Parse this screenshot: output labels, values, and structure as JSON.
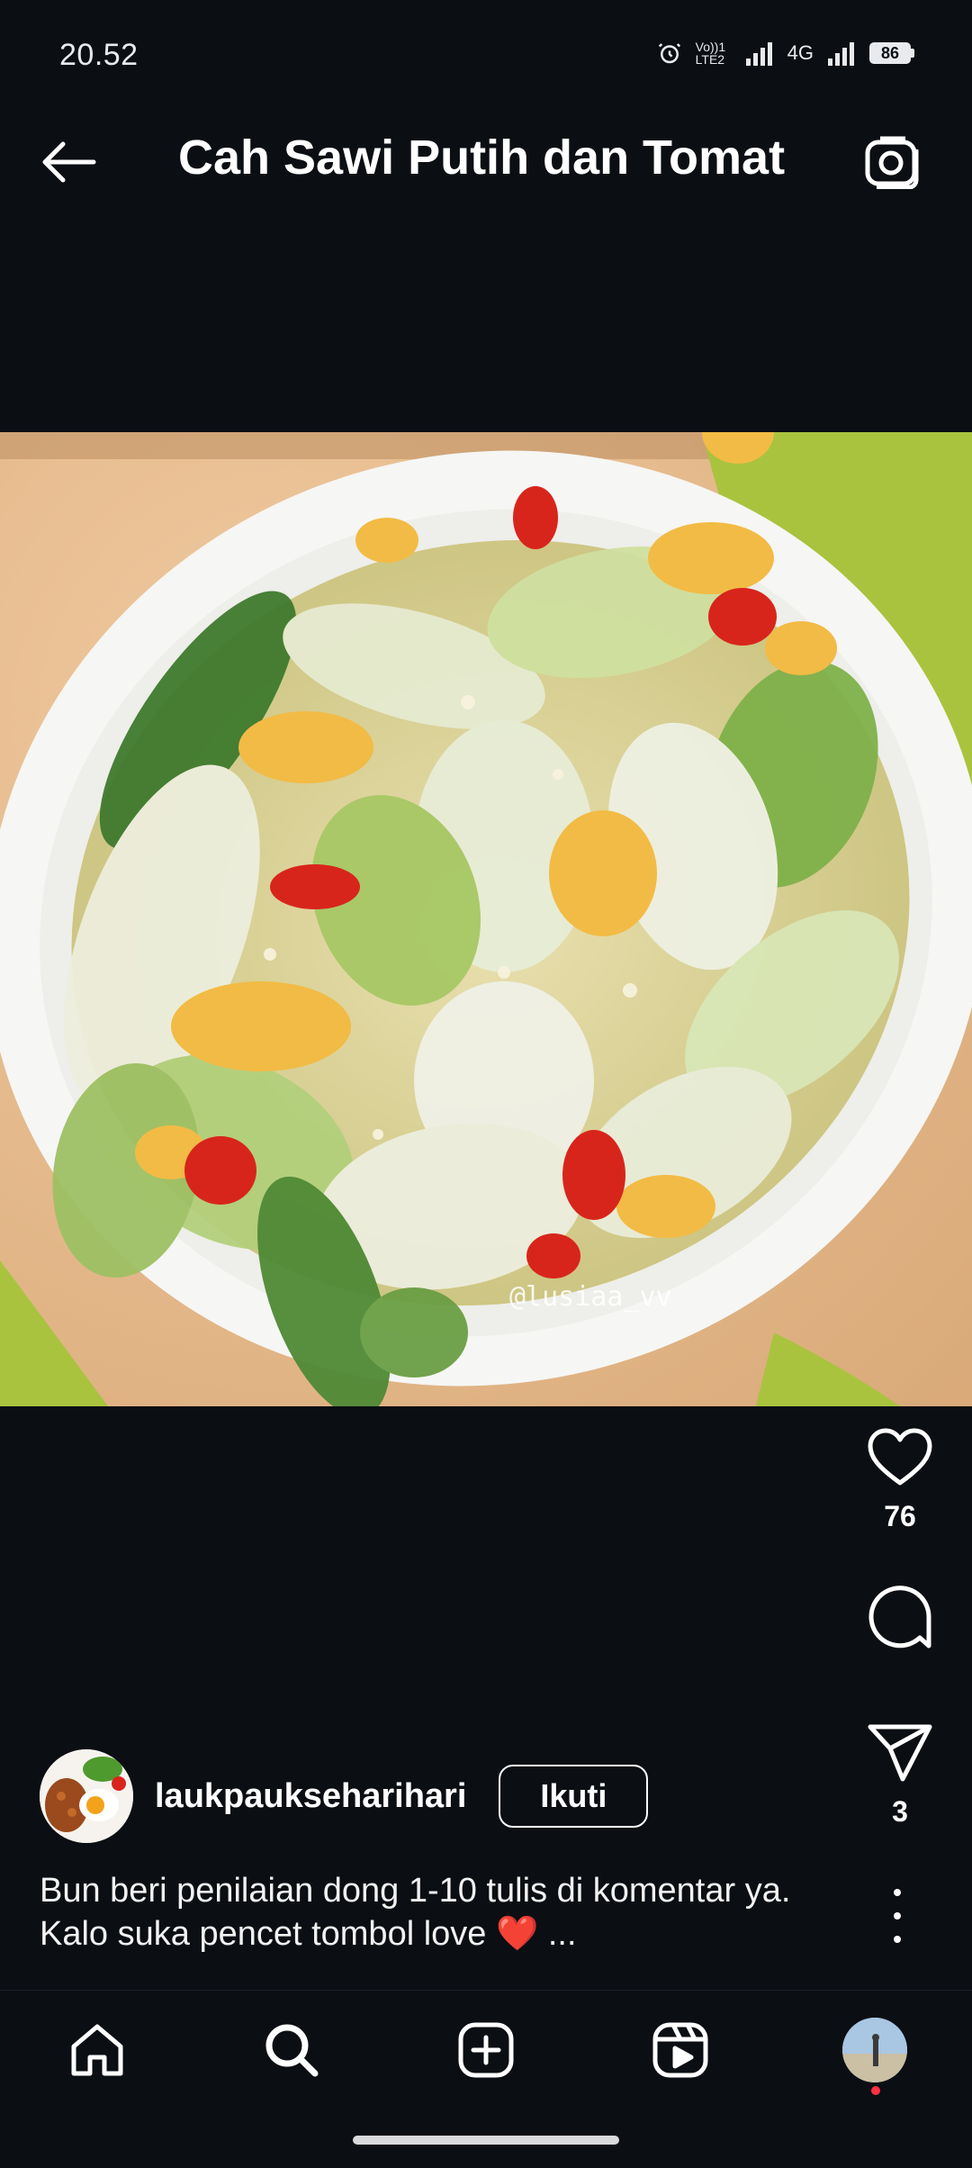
{
  "status_bar": {
    "time": "20.52",
    "volte": "Vo))1 LTE2",
    "network": "4G",
    "battery": "86"
  },
  "header": {
    "title": "Cah Sawi Putih dan Tomat",
    "back_icon": "arrow-left-icon",
    "camera_icon": "camera-icon"
  },
  "post": {
    "image_description": "Stir-fried napa cabbage with scrambled egg and red chili on a white oval plate",
    "watermark": "@lusiaa_vv",
    "likes": "76",
    "shares": "3",
    "author": "laukpaukseharihari",
    "follow_label": "Ikuti",
    "caption_line1": "Bun beri penilaian dong 1-10 tulis di komentar ya.",
    "caption_line2": "Kalo suka pencet tombol love",
    "caption_heart": "❤️",
    "caption_more": "..."
  },
  "nav": {
    "items": [
      "home-icon",
      "search-icon",
      "create-icon",
      "reels-icon",
      "profile-avatar"
    ]
  },
  "colors": {
    "background": "#0b0e13",
    "text": "#ffffff",
    "heart": "#e11b2b",
    "notification": "#ff3040"
  }
}
